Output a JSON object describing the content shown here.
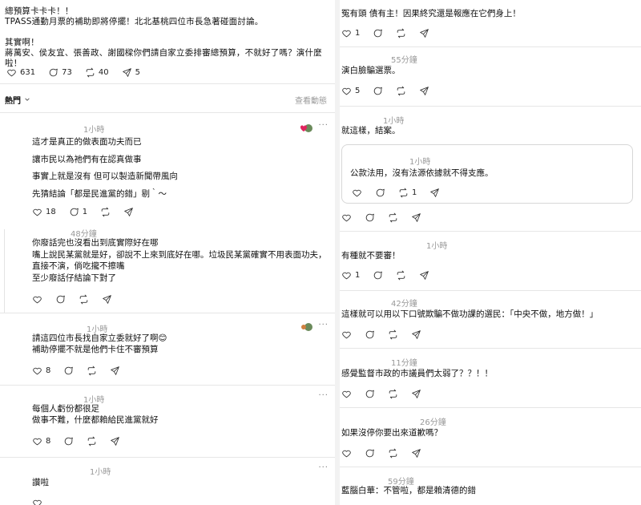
{
  "left": {
    "main_post": {
      "text": "總預算卡卡卡！！\nTPASS通勤月票的補助即將停擺！北北基桃四位市長急著碰面討論。\n\n其實啊！\n蔣萬安、侯友宜、張善政、謝國樑你們請自家立委排審總預算，不就好了嗎？演什麼啦！",
      "likes": "631",
      "replies": "73",
      "reposts": "40",
      "shares": "5"
    },
    "sort": {
      "label": "熱門",
      "view_activity": "查看動態"
    },
    "comments": [
      {
        "time": "1小時",
        "text": "這才是真正的做表面功夫而已\n讓市民以為祂們有在認真做事\n事實上就是沒有 但可以製造新聞帶風向\n先猜結論「都是民進黨的錯」剔｀～",
        "likes": "18",
        "replies": "1"
      },
      {
        "time": "48分鐘",
        "text": "你廢話完也沒看出到底實際好在哪\n嘴上說民某黨就是好，卻說不上來到底好在哪。垃圾民某黨確實不用表面功夫，直接不演，倘吃攏不擦嘴\n至少廢話仔結論下對了",
        "likes": "",
        "replies": ""
      },
      {
        "time": "1小時",
        "text": "請這四位市長找自家立委就好了啊😊\n補助停擺不就是他們卡住不審預算",
        "likes": "8",
        "replies": ""
      },
      {
        "time": "1小時",
        "text": "每個人虧份都很足\n做事不難，什麼都賴給民進黨就好",
        "likes": "8",
        "replies": ""
      },
      {
        "time": "1小時",
        "text": "讚啦",
        "likes": "",
        "replies": ""
      }
    ]
  },
  "right": {
    "items": [
      {
        "time": "",
        "text": "冤有頭 債有主！因果終究還是報應在它們身上！",
        "likes": "1"
      },
      {
        "time": "55分鐘",
        "text": "演白臉騙選票。",
        "likes": "5"
      },
      {
        "time": "1小時",
        "text": "就這樣，結案。",
        "likes": ""
      },
      {
        "time": "1小時",
        "text": "公款法用，沒有法源依據就不得支應。",
        "likes": "",
        "replies": "",
        "reposts": "1"
      },
      {
        "time": "1小時",
        "text": "有種就不要審！",
        "likes": "1"
      },
      {
        "time": "42分鐘",
        "text": "這樣就可以用以下口號欺騙不做功課的選民：「中央不做，地方做！」",
        "likes": ""
      },
      {
        "time": "11分鐘",
        "text": "感覺監督市政的市議員們太弱了？？！！",
        "likes": ""
      },
      {
        "time": "26分鐘",
        "text": "如果沒停你要出來道歉嗎？",
        "likes": ""
      },
      {
        "time": "59分鐘",
        "text": "藍腦白華：不管啦，都是賴清德的錯",
        "likes": ""
      }
    ]
  },
  "icons": [
    "heart-icon",
    "comment-icon",
    "repost-icon",
    "share-icon",
    "more-icon",
    "chevron-down-icon"
  ]
}
